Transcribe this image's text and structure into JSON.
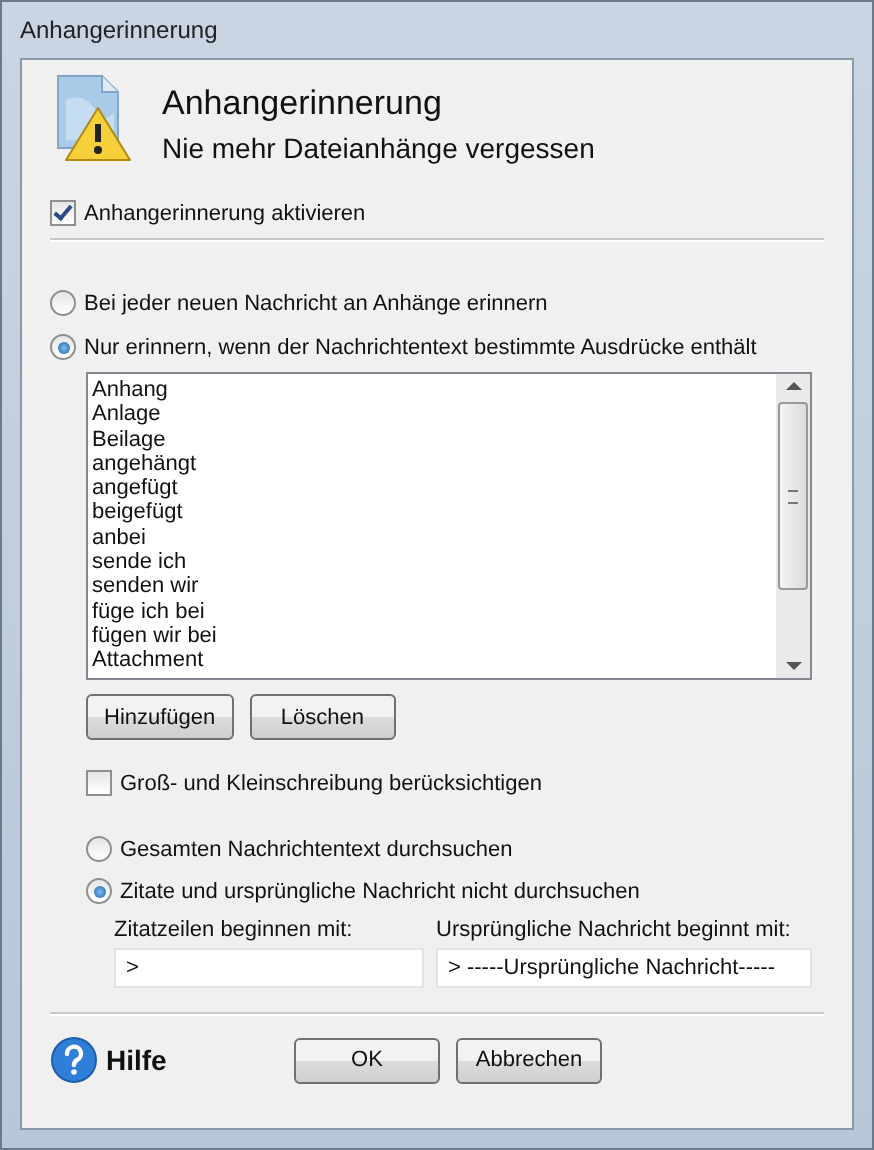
{
  "window": {
    "title": "Anhangerinnerung"
  },
  "header": {
    "title": "Anhangerinnerung",
    "subtitle": "Nie mehr Dateianhänge vergessen"
  },
  "enable_checkbox": {
    "label": "Anhangerinnerung aktivieren",
    "checked": true
  },
  "remind_options": [
    {
      "label": "Bei jeder neuen Nachricht an Anhänge erinnern",
      "selected": false
    },
    {
      "label": "Nur erinnern, wenn der Nachrichtentext bestimmte Ausdrücke enthält",
      "selected": true
    }
  ],
  "keywords": [
    "Anhang",
    "Anlage",
    "Beilage",
    "angehängt",
    "angefügt",
    "beigefügt",
    "anbei",
    "sende ich",
    "senden wir",
    "füge ich bei",
    "fügen wir bei",
    "Attachment"
  ],
  "list_buttons": [
    "Hinzufügen",
    "Löschen"
  ],
  "case_checkbox": {
    "label": "Groß- und Kleinschreibung berücksichtigen",
    "checked": false
  },
  "search_options": [
    {
      "label": "Gesamten Nachrichtentext durchsuchen",
      "selected": false
    },
    {
      "label": "Zitate und ursprüngliche Nachricht nicht durchsuchen",
      "selected": true
    }
  ],
  "fields": [
    {
      "label": "Zitatzeilen beginnen mit:",
      "value": ">"
    },
    {
      "label": "Ursprüngliche Nachricht beginnt mit:",
      "value": "> -----Ursprüngliche Nachricht-----"
    }
  ],
  "help": {
    "label": "Hilfe"
  },
  "buttons": [
    "OK",
    "Abbrechen"
  ]
}
